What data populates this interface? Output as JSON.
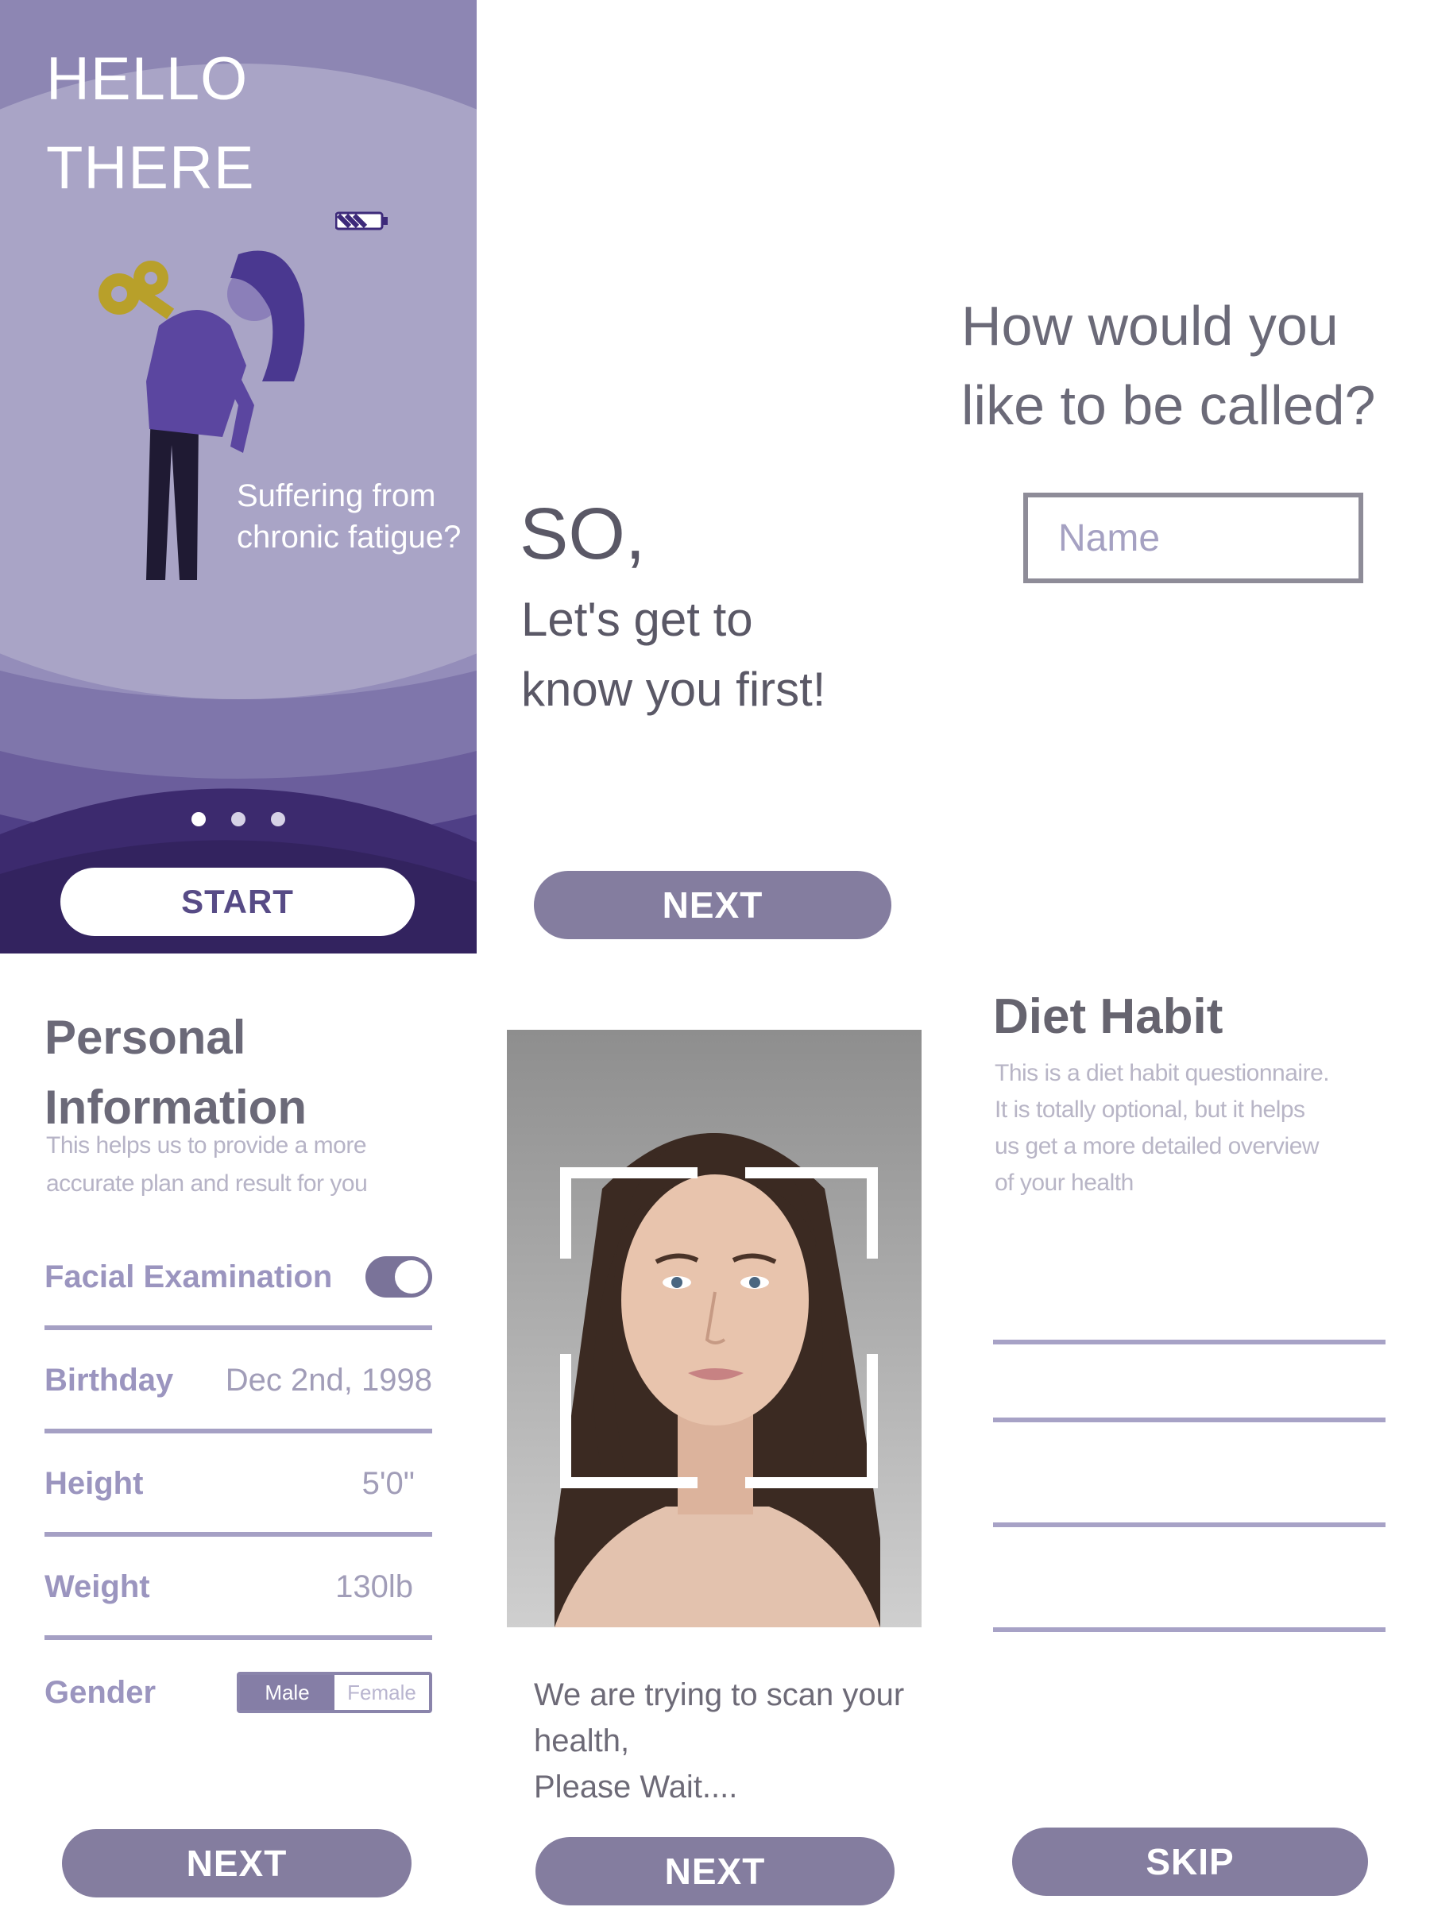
{
  "welcome": {
    "greeting_line1": "HELLO",
    "greeting_line2": "THERE",
    "tagline_line1": "Suffering from",
    "tagline_line2": "chronic fatigue?",
    "start_label": "START",
    "page_count": 3,
    "active_page": 1
  },
  "intro": {
    "so": "SO,",
    "subtitle_line1": "Let's get to",
    "subtitle_line2": "know you first!",
    "next_label": "NEXT"
  },
  "name": {
    "question_line1": "How would you",
    "question_line2": "like to be called?",
    "placeholder": "Name",
    "value": ""
  },
  "personal": {
    "title_line1": "Personal",
    "title_line2": "Information",
    "subtitle_line1": "This helps us to provide a more",
    "subtitle_line2": "accurate plan and result for you",
    "facial_label": "Facial Examination",
    "facial_enabled": true,
    "birthday_label": "Birthday",
    "birthday_value": "Dec 2nd, 1998",
    "height_label": "Height",
    "height_value": "5'0\"",
    "weight_label": "Weight",
    "weight_value": "130lb",
    "gender_label": "Gender",
    "gender_options": [
      "Male",
      "Female"
    ],
    "gender_selected": "Male",
    "next_label": "NEXT"
  },
  "scan": {
    "message_line1": "We are trying to scan your",
    "message_line2": "health,",
    "message_line3": "Please Wait....",
    "next_label": "NEXT"
  },
  "diet": {
    "title": "Diet Habit",
    "desc_line1": "This is a diet habit questionnaire.",
    "desc_line2": "It is totally optional, but it helps",
    "desc_line3": "us get a more detailed overview",
    "desc_line4": "of your health",
    "skip_label": "SKIP"
  },
  "colors": {
    "primary": "#847d9f",
    "welcome_bg": "#a9a4c6",
    "wave_dark": "#3f2d70",
    "accent_line": "#a5a0c4"
  }
}
